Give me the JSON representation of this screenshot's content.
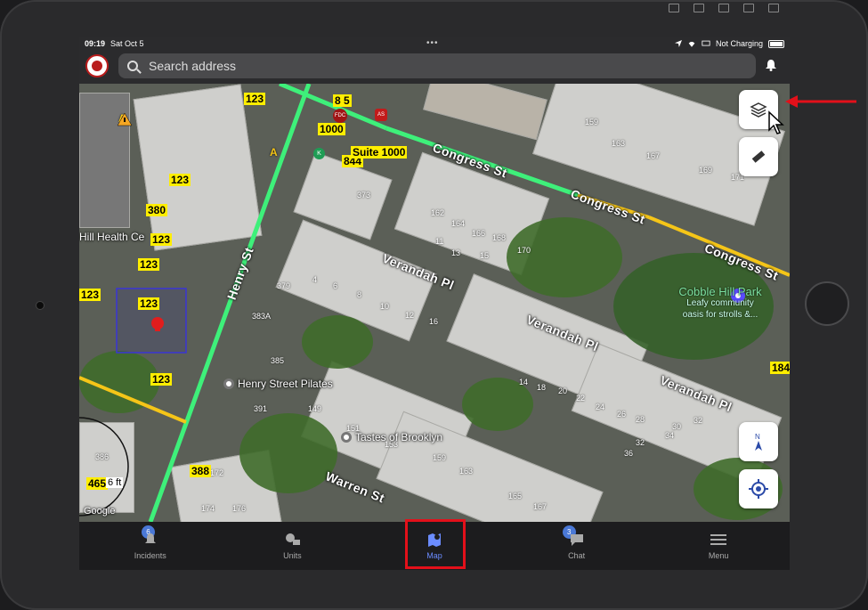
{
  "statusbar": {
    "time": "09:19",
    "date": "Sat Oct 5",
    "charging": "Not Charging"
  },
  "search": {
    "placeholder": "Search address"
  },
  "map": {
    "streets": [
      "Congress St",
      "Congress St",
      "Congress St",
      "Henry St",
      "Verandah Pl",
      "Verandah Pl",
      "Verandah Pl",
      "Warren St"
    ],
    "tags": [
      "123",
      "1000",
      "844",
      "Suite 1000",
      "123",
      "380",
      "123",
      "123",
      "123",
      "123",
      "123",
      "465",
      "388",
      "8 5",
      "184"
    ],
    "numbers": [
      "159",
      "163",
      "167",
      "169",
      "171",
      "162",
      "164",
      "166",
      "168",
      "170",
      "373",
      "11",
      "13",
      "15",
      "379",
      "4",
      "6",
      "8",
      "10",
      "12",
      "16",
      "383A",
      "385",
      "391",
      "149",
      "151",
      "153",
      "159",
      "163",
      "165",
      "167",
      "172",
      "174",
      "176",
      "14",
      "18",
      "20",
      "22",
      "24",
      "26",
      "28",
      "30",
      "32",
      "34",
      "386",
      "32",
      "36"
    ],
    "pois": {
      "pilates": "Henry Street Pilates",
      "tastes": "Tastes of Brooklyn",
      "park_name": "Cobble Hill Park",
      "park_desc": "Leafy community oasis for strolls &...",
      "health": "Hill Health Ce",
      "google": "Google",
      "distance": "6 ft",
      "fdc": "FDC",
      "as": "AS",
      "k": "K",
      "a1": "A",
      "a2": "A"
    }
  },
  "tabs": [
    {
      "label": "Incidents",
      "badge": "6"
    },
    {
      "label": "Units"
    },
    {
      "label": "Map"
    },
    {
      "label": "Chat",
      "badge": "3"
    },
    {
      "label": "Menu"
    }
  ],
  "colors": {
    "accent": "#6b8cff",
    "highlight": "#e3101a",
    "tag": "#ffee00",
    "road_green": "#3ef07a",
    "road_yellow": "#f5c518"
  }
}
